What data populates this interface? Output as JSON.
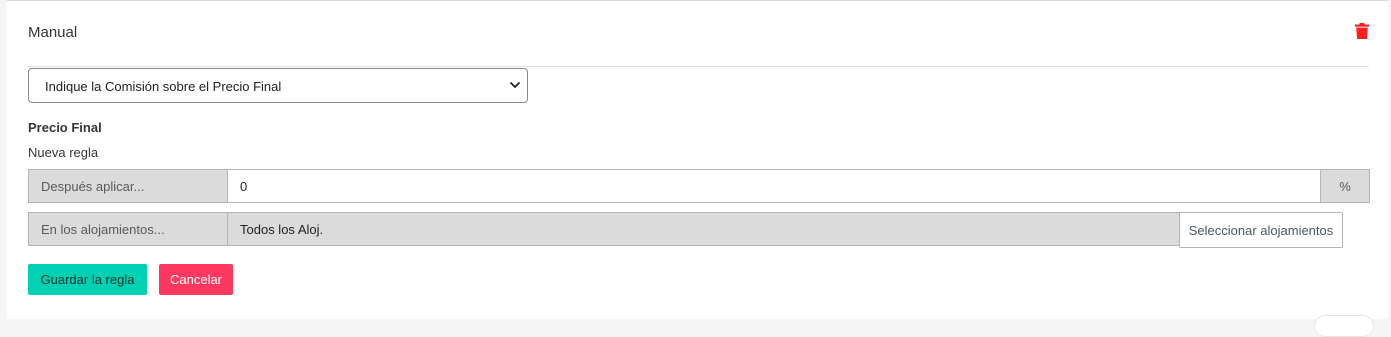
{
  "header": {
    "title": "Manual"
  },
  "commission_select": {
    "selected": "Indique la Comisión sobre el Precio Final"
  },
  "section": {
    "title": "Precio Final",
    "subtitle": "Nueva regla"
  },
  "apply_row": {
    "label": "Después aplicar...",
    "value": "0",
    "unit": "%"
  },
  "lodging_row": {
    "label": "En los alojamientos...",
    "value": "Todos los Aloj.",
    "button": "Seleccionar alojamientos"
  },
  "actions": {
    "save": "Guardar la regla",
    "cancel": "Cancelar"
  },
  "colors": {
    "save": "#00d1b2",
    "cancel": "#ff3860",
    "delete": "#ff1f1f"
  },
  "icons": {
    "delete": "trash-icon",
    "select": "chevron-down-icon"
  }
}
